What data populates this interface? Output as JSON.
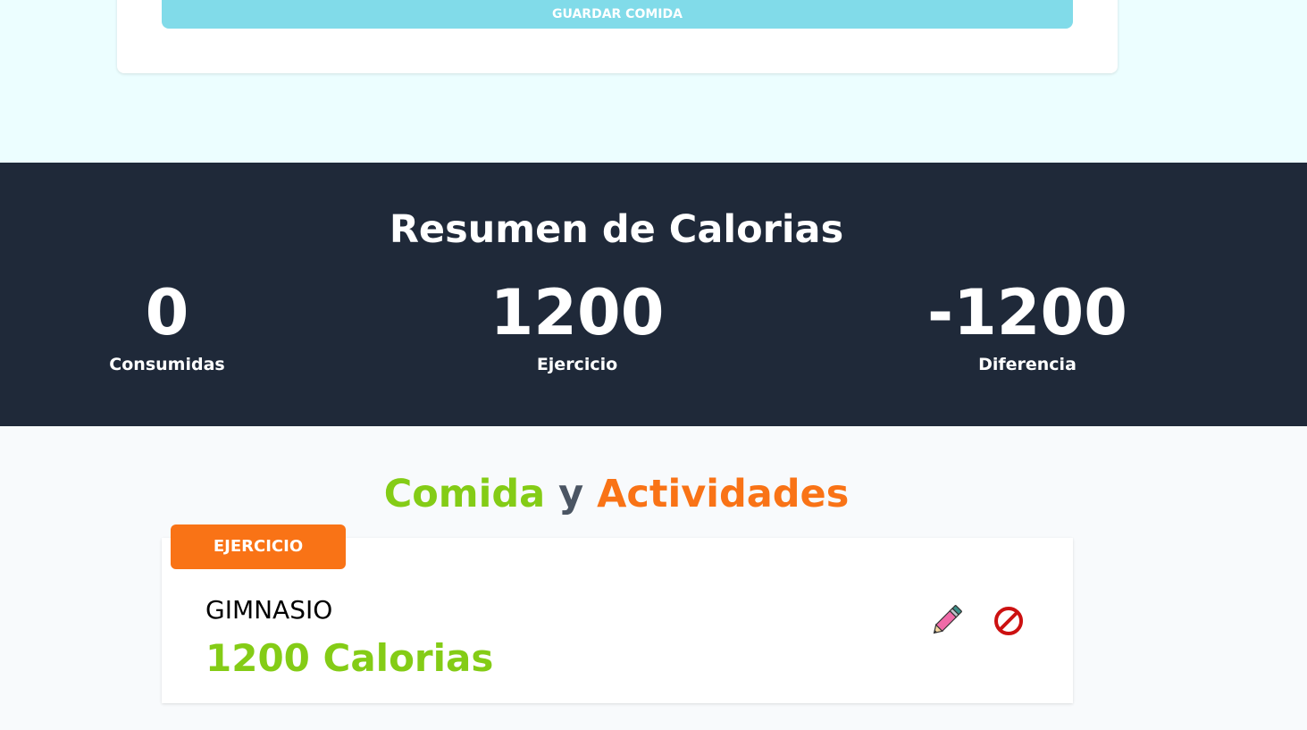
{
  "form": {
    "save_label": "Guardar comida"
  },
  "summary": {
    "title": "Resumen de Calorias",
    "consumed": {
      "value": "0",
      "label": "Consumidas"
    },
    "exercise": {
      "value": "1200",
      "label": "Ejercicio"
    },
    "difference": {
      "value": "-1200",
      "label": "Diferencia"
    }
  },
  "activities": {
    "title_food": "Comida",
    "title_and": "y",
    "title_activities": "Actividades",
    "items": [
      {
        "category": "Ejercicio",
        "name": "Gimnasio",
        "calories": "1200 Calorias"
      }
    ]
  },
  "icons": {
    "edit": "pencil-icon",
    "delete": "prohibited-icon"
  },
  "colors": {
    "page_bg_top": "#ecfeff",
    "summary_bg": "#1f2939",
    "food_accent": "#84cc16",
    "activity_accent": "#f97316",
    "save_button": "#81dbe9"
  }
}
